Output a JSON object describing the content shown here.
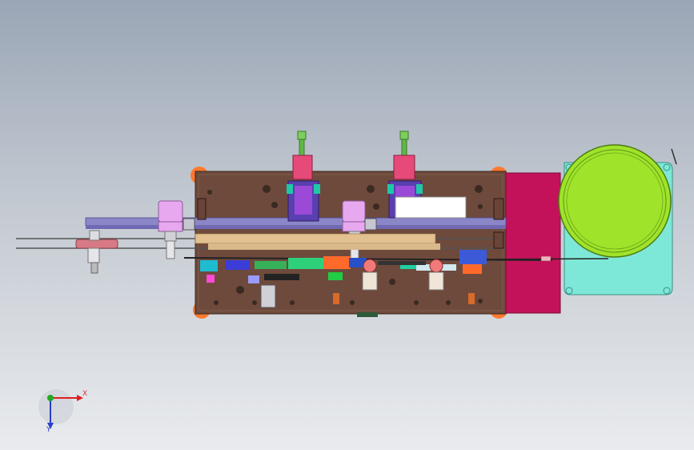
{
  "triad": {
    "x_label": "X",
    "y_label": "Y",
    "x_color": "#e02020",
    "y_color": "#2a3fc8",
    "z_color": "#22aa22"
  },
  "colors": {
    "background_top": "#9aa6b6",
    "background_bottom": "#e9ebee",
    "base_plate": "#6e4a3c",
    "rail": "#8b86c8",
    "side_block": "#c4125a",
    "drum": "#7ee8d8",
    "reel": "#9fe32a",
    "cylinder": "#e64a78",
    "spindle": "#e7a8f0",
    "corner_pad": "#ff7a2e"
  }
}
